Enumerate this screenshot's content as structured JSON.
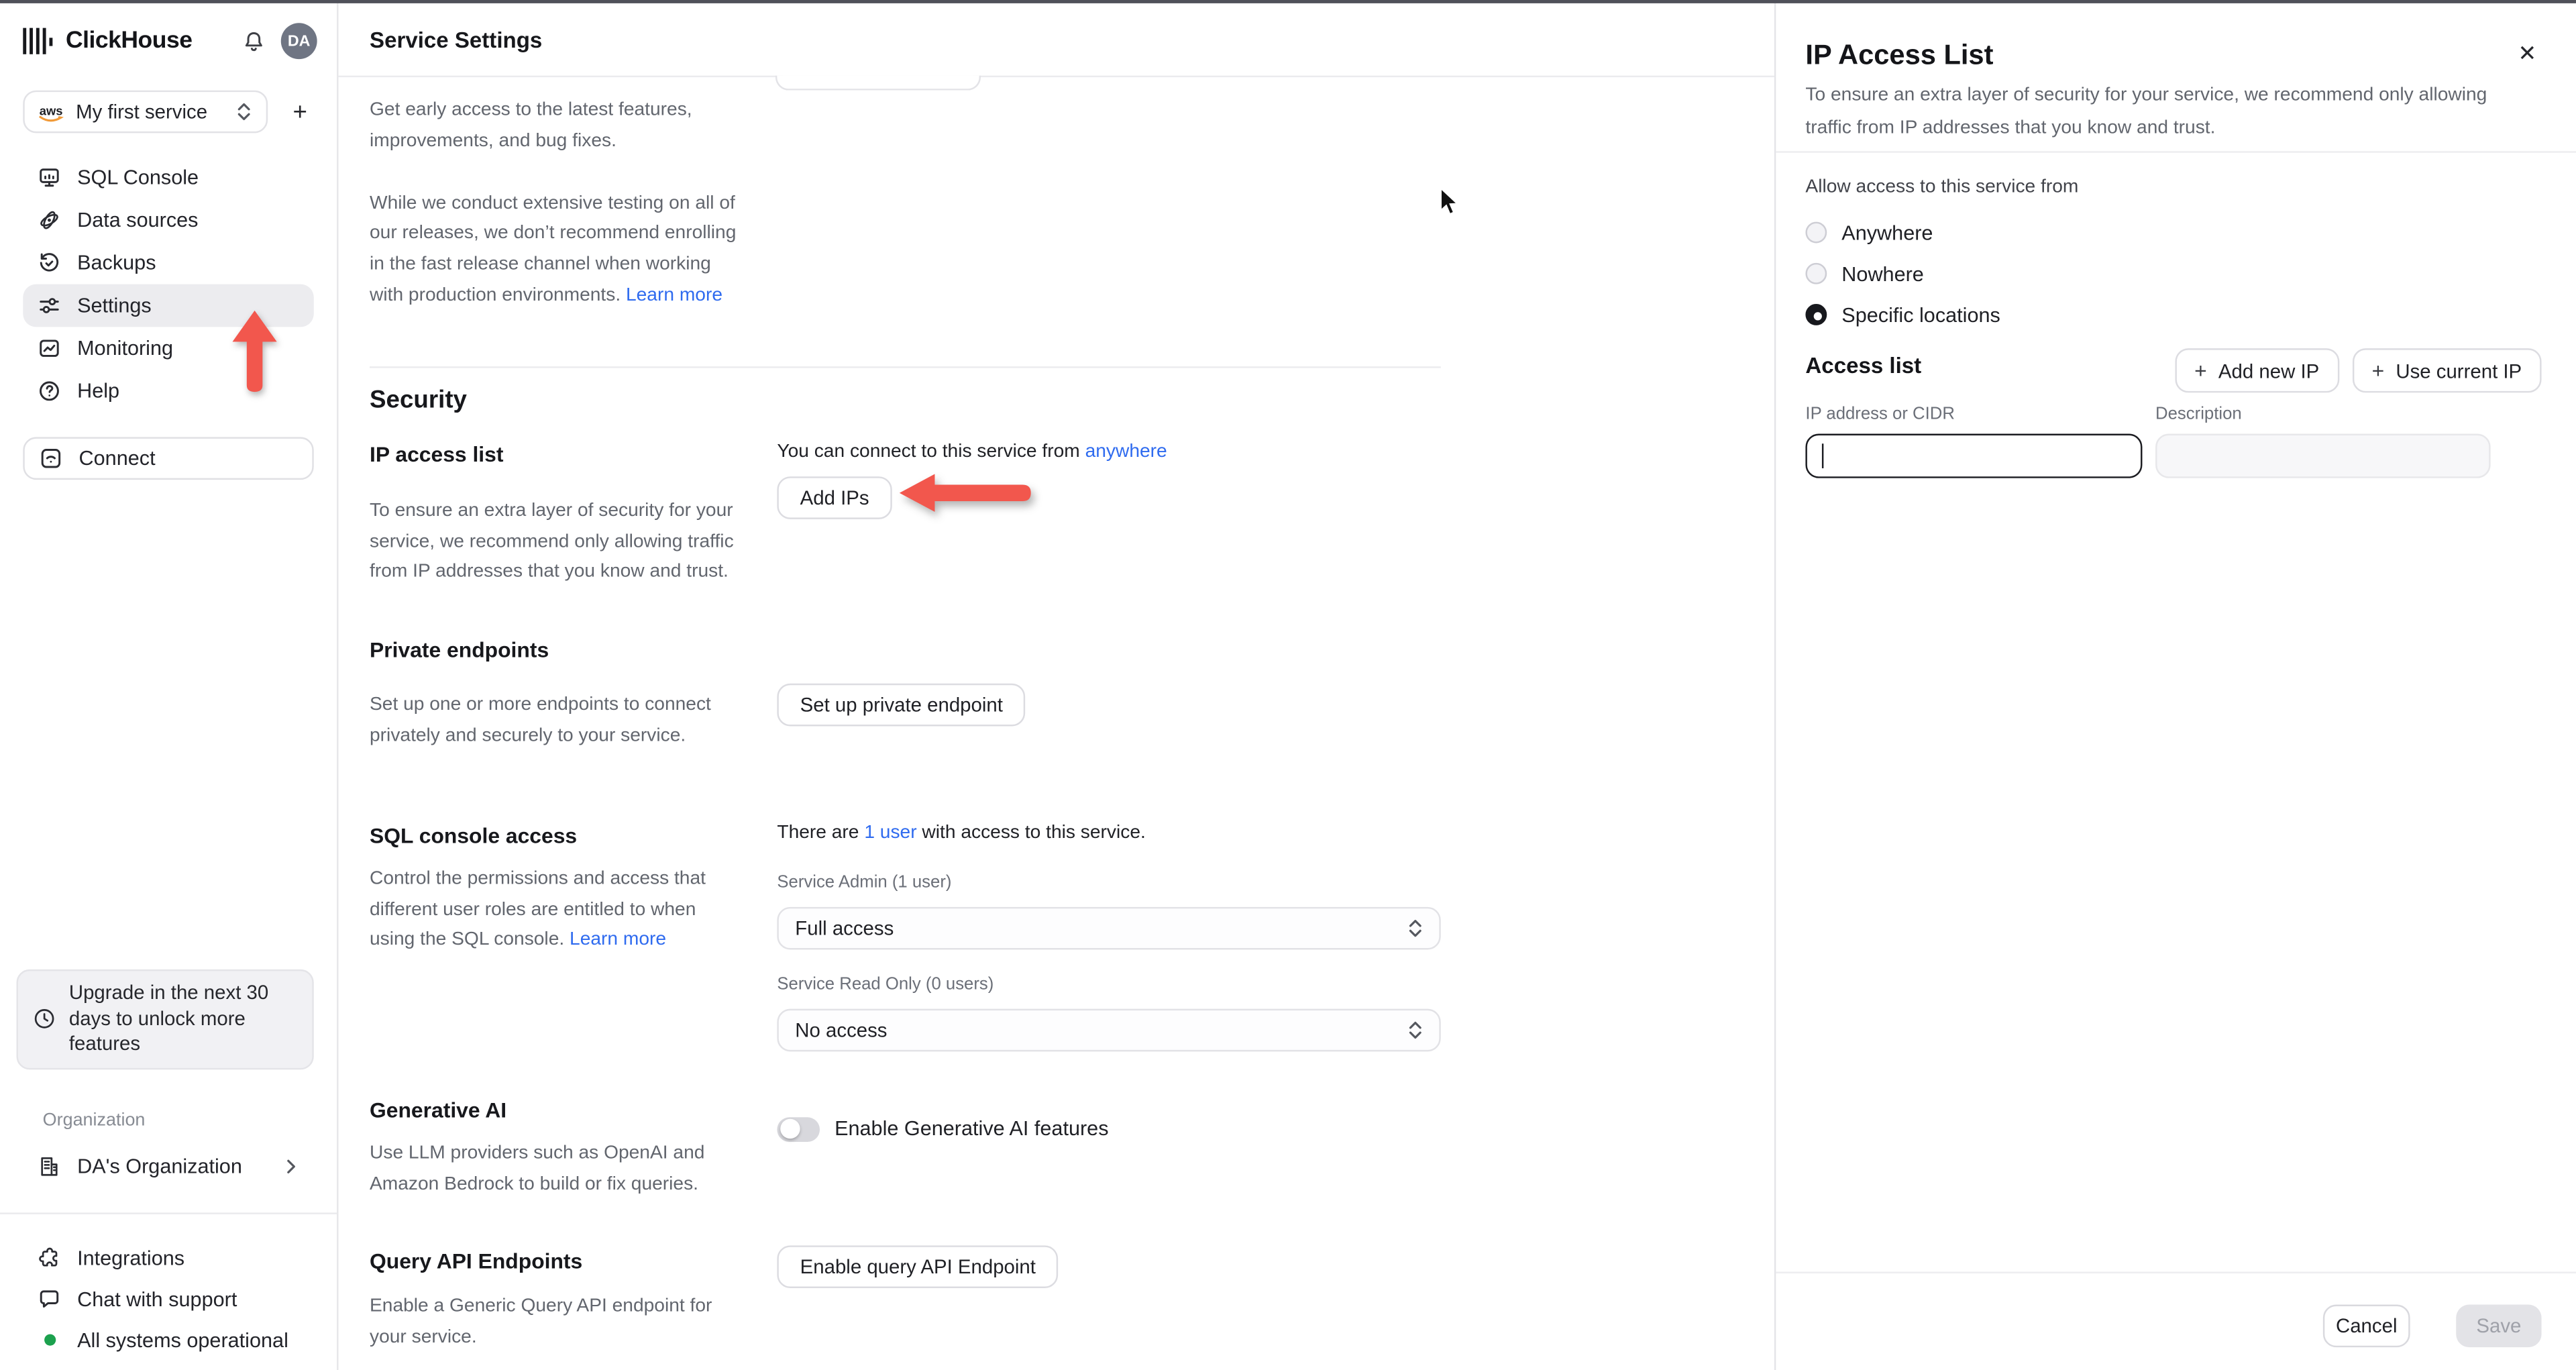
{
  "colors": {
    "link_blue": "#2f6bef",
    "arrow_red": "#f2574d",
    "status_green": "#1ca14e",
    "avatar_bg": "#6f7583",
    "active_item_bg": "#ececef",
    "top_bar": "#50515a"
  },
  "sidebar": {
    "logo_text": "ClickHouse",
    "avatar_initials": "DA",
    "service_selector": {
      "provider": "aws",
      "label": "My first service"
    },
    "add_service_label": "+",
    "nav": [
      {
        "label": "SQL Console"
      },
      {
        "label": "Data sources"
      },
      {
        "label": "Backups"
      },
      {
        "label": "Settings"
      },
      {
        "label": "Monitoring"
      },
      {
        "label": "Help"
      }
    ],
    "connect_label": "Connect",
    "upgrade_notice": "Upgrade in the next 30 days to unlock more features",
    "organization_label": "Organization",
    "organization_name": "DA's Organization",
    "footer_items": [
      {
        "label": "Integrations"
      },
      {
        "label": "Chat with support"
      },
      {
        "label": "All systems operational"
      }
    ]
  },
  "main": {
    "header_title": "Service Settings",
    "fast_release": {
      "p1": "Get early access to the latest features, improvements, and bug fixes.",
      "p2": "While we conduct extensive testing on all of our releases, we don’t recommend enrolling in the fast release channel when working with production environments. ",
      "learn_more": "Learn more"
    },
    "security_heading": "Security",
    "ip_access": {
      "title": "IP access list",
      "description": "To ensure an extra layer of security for your service, we recommend only allowing traffic from IP addresses that you know and trust.",
      "status_prefix": "You can connect to this service from ",
      "status_link": "anywhere",
      "button": "Add IPs"
    },
    "private_endpoints": {
      "title": "Private endpoints",
      "description": "Set up one or more endpoints to connect privately and securely to your service.",
      "button": "Set up private endpoint"
    },
    "sql_console_access": {
      "title": "SQL console access",
      "status_prefix": "There are ",
      "status_link": "1 user",
      "status_suffix": " with access to this service.",
      "description": "Control the permissions and access that different user roles are entitled to when using the SQL console. ",
      "learn_more": "Learn more",
      "admin_label": "Service Admin (1 user)",
      "admin_value": "Full access",
      "readonly_label": "Service Read Only (0 users)",
      "readonly_value": "No access"
    },
    "generative_ai": {
      "title": "Generative AI",
      "toggle_label": "Enable Generative AI features",
      "description": "Use LLM providers such as OpenAI and Amazon Bedrock to build or fix queries."
    },
    "query_api": {
      "title": "Query API Endpoints",
      "button": "Enable query API Endpoint",
      "description": "Enable a Generic Query API endpoint for your service."
    }
  },
  "panel": {
    "title": "IP Access List",
    "close_symbol": "✕",
    "description": "To ensure an extra layer of security for your service, we recommend only allowing traffic from IP addresses that you know and trust.",
    "allow_label": "Allow access to this service from",
    "radios": [
      {
        "label": "Anywhere",
        "selected": false
      },
      {
        "label": "Nowhere",
        "selected": false
      },
      {
        "label": "Specific locations",
        "selected": true
      }
    ],
    "access_list_heading": "Access list",
    "add_new_ip_label": "Add new IP",
    "use_current_ip_label": "Use current IP",
    "plus_symbol": "+",
    "ip_field_label": "IP address or CIDR",
    "desc_field_label": "Description",
    "ip_value": "",
    "desc_value": "",
    "cancel_label": "Cancel",
    "save_label": "Save"
  }
}
